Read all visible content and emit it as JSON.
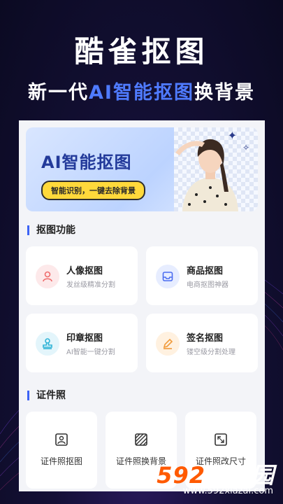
{
  "hero": {
    "title": "酷雀抠图",
    "subtitle_before": "新一代",
    "subtitle_highlight": "AI智能抠图",
    "subtitle_after": "换背景"
  },
  "banner": {
    "title": "AI智能抠图",
    "pill": "智能识别，一键去除背景"
  },
  "sections": {
    "cutout_title": "抠图功能",
    "idphoto_title": "证件照"
  },
  "features": [
    {
      "title": "人像抠图",
      "desc": "发丝级精准分割",
      "icon": "person-icon"
    },
    {
      "title": "商品抠图",
      "desc": "电商抠图神器",
      "icon": "inbox-icon"
    },
    {
      "title": "印章抠图",
      "desc": "AI智能一键分割",
      "icon": "stamp-icon"
    },
    {
      "title": "签名抠图",
      "desc": "镂空级分割处理",
      "icon": "pen-icon"
    }
  ],
  "id_tools": [
    {
      "label": "证件照抠图",
      "icon": "portrait-icon"
    },
    {
      "label": "证件照换背景",
      "icon": "background-icon"
    },
    {
      "label": "证件照改尺寸",
      "icon": "resize-icon"
    }
  ],
  "watermark": {
    "brand_num": "592",
    "brand_text": "软件园",
    "url": "www.592xiazai.com"
  },
  "colors": {
    "accent": "#3d63f5",
    "highlight": "#4f7bff",
    "background": "#141036"
  }
}
